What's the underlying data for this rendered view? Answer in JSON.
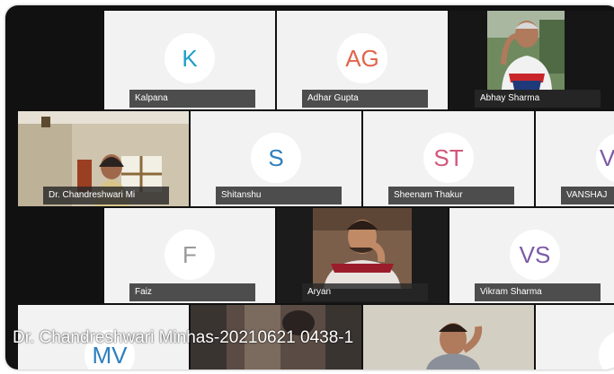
{
  "colors": {
    "tile_bg": "#f2f2f2",
    "frame_bg": "#111111",
    "avatar_teal": "#1e9fc9",
    "avatar_coral": "#e0664b",
    "avatar_pink": "#d2567c",
    "avatar_gray": "#9a9a9a",
    "avatar_purple": "#7b5aa6",
    "avatar_blue": "#2d7fbf"
  },
  "participants": [
    {
      "name": "Kalpana",
      "initials": "K"
    },
    {
      "name": "Adhar Gupta",
      "initials": "AG"
    },
    {
      "name": "Abhay Sharma",
      "video": true
    },
    {
      "name": "Dr. Chandreshwari Mi",
      "video": true
    },
    {
      "name": "Shitanshu",
      "initials": "S"
    },
    {
      "name": "Sheenam Thakur",
      "initials": "ST"
    },
    {
      "name": "VANSHAJ",
      "initials": "V"
    },
    {
      "name": "Faiz",
      "initials": "F"
    },
    {
      "name": "Aryan",
      "video": true
    },
    {
      "name": "Vikram Sharma",
      "initials": "VS"
    },
    {
      "initials": "MV"
    }
  ],
  "recording_caption": "Dr. Chandreshwari Minhas-20210621 0438-1"
}
